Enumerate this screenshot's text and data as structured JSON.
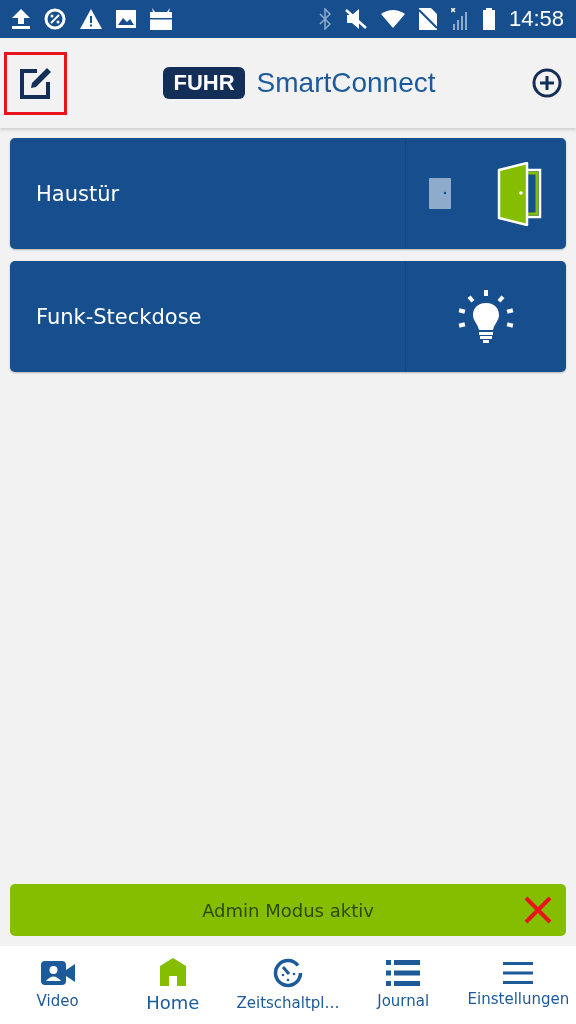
{
  "status_bar": {
    "time": "14:58"
  },
  "header": {
    "logo_badge": "FUHR",
    "logo_text": "SmartConnect",
    "edit_highlighted": true
  },
  "devices": [
    {
      "kind": "door",
      "name": "Haustür"
    },
    {
      "kind": "light",
      "name": "Funk-Steckdose"
    }
  ],
  "admin_banner": {
    "text": "Admin Modus aktiv"
  },
  "nav": [
    {
      "kind": "video",
      "label": "Video",
      "selected": false
    },
    {
      "kind": "home",
      "label": "Home",
      "selected": true
    },
    {
      "kind": "timer",
      "label": "Zeitschaltpl…",
      "selected": false
    },
    {
      "kind": "list",
      "label": "Journal",
      "selected": false
    },
    {
      "kind": "menu",
      "label": "Einstellungen",
      "selected": false
    }
  ]
}
